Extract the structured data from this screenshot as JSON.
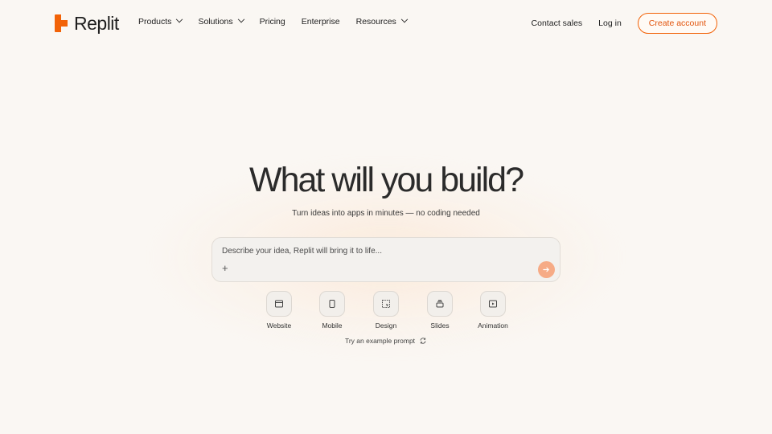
{
  "brand": {
    "name": "Replit",
    "accent": "#f26207"
  },
  "nav": {
    "items": [
      {
        "label": "Products",
        "has_dropdown": true
      },
      {
        "label": "Solutions",
        "has_dropdown": true
      },
      {
        "label": "Pricing",
        "has_dropdown": false
      },
      {
        "label": "Enterprise",
        "has_dropdown": false
      },
      {
        "label": "Resources",
        "has_dropdown": true
      }
    ],
    "contact_sales": "Contact sales",
    "log_in": "Log in",
    "create_account": "Create account"
  },
  "hero": {
    "title": "What will you build?",
    "subtitle": "Turn ideas into apps in minutes — no coding needed"
  },
  "prompt": {
    "placeholder": "Describe your idea, Replit will bring it to life...",
    "value": "",
    "attach_icon": "plus-icon",
    "send_icon": "arrow-right-icon"
  },
  "types": [
    {
      "label": "Website",
      "icon": "browser-window-icon"
    },
    {
      "label": "Mobile",
      "icon": "phone-icon"
    },
    {
      "label": "Design",
      "icon": "design-select-icon"
    },
    {
      "label": "Slides",
      "icon": "slides-icon"
    },
    {
      "label": "Animation",
      "icon": "play-window-icon"
    }
  ],
  "example_prompt": {
    "label": "Try an example prompt",
    "icon": "refresh-icon"
  }
}
